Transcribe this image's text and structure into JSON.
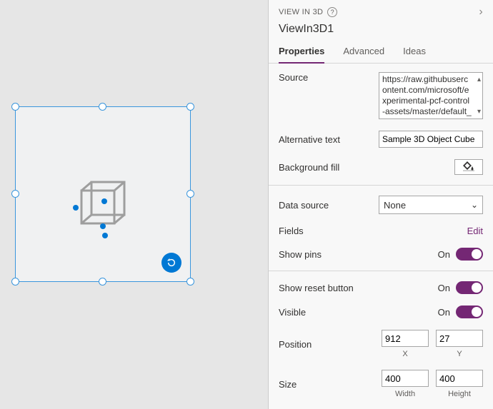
{
  "header": {
    "view_label": "VIEW IN 3D",
    "instance": "ViewIn3D1"
  },
  "tabs": {
    "properties": "Properties",
    "advanced": "Advanced",
    "ideas": "Ideas"
  },
  "props": {
    "source_label": "Source",
    "source_value": "https://raw.githubusercontent.com/microsoft/experimental-pcf-control-assets/master/default_",
    "alt_label": "Alternative text",
    "alt_value": "Sample 3D Object Cube",
    "bgfill_label": "Background fill",
    "datasource_label": "Data source",
    "datasource_value": "None",
    "fields_label": "Fields",
    "fields_action": "Edit",
    "showpins_label": "Show pins",
    "showreset_label": "Show reset button",
    "visible_label": "Visible",
    "toggle_on": "On",
    "position_label": "Position",
    "position_x": "912",
    "position_y": "27",
    "x_label": "X",
    "y_label": "Y",
    "size_label": "Size",
    "size_w": "400",
    "size_h": "400",
    "w_label": "Width",
    "h_label": "Height"
  }
}
